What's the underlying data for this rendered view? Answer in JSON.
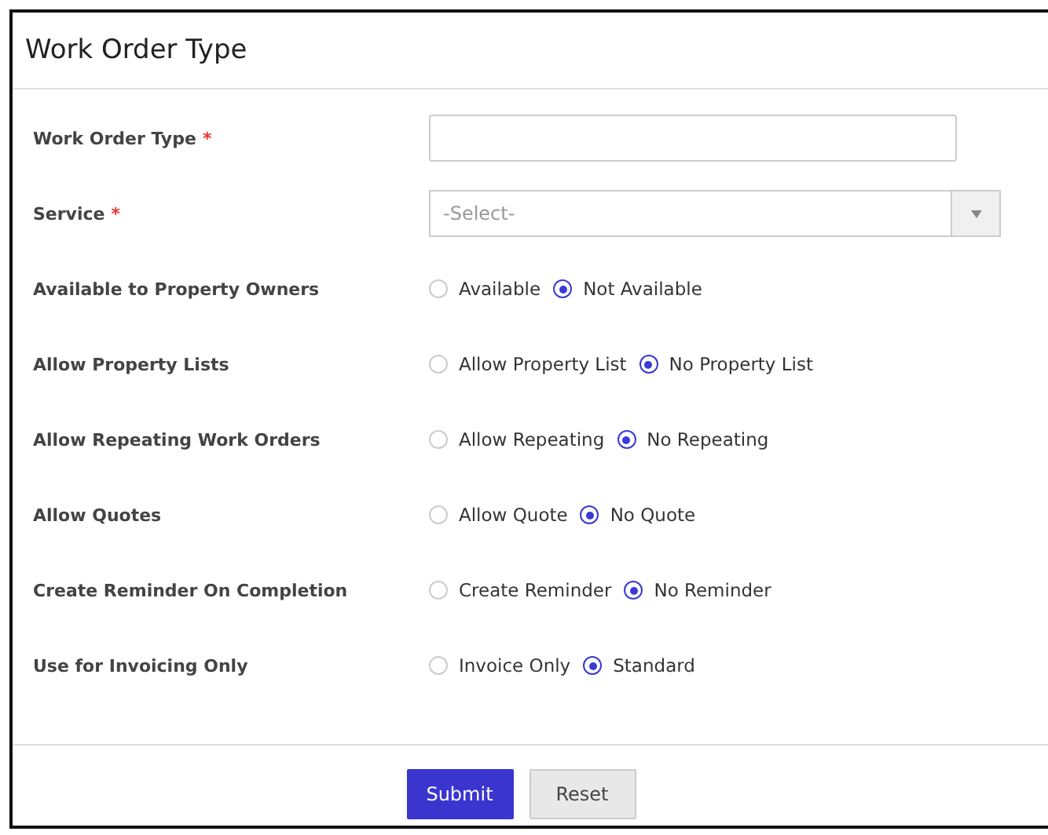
{
  "dialog": {
    "title": "Work Order Type"
  },
  "fields": [
    {
      "kind": "text",
      "label": "Work Order Type",
      "required_mark": "*"
    },
    {
      "kind": "select",
      "label": "Service",
      "required_mark": "*",
      "placeholder": "-Select-"
    },
    {
      "kind": "radio",
      "label": "Available to Property Owners",
      "options": [
        {
          "label": "Available",
          "selected": false
        },
        {
          "label": "Not Available",
          "selected": true
        }
      ]
    },
    {
      "kind": "radio",
      "label": "Allow Property Lists",
      "options": [
        {
          "label": "Allow Property List",
          "selected": false
        },
        {
          "label": "No Property List",
          "selected": true
        }
      ]
    },
    {
      "kind": "radio",
      "label": "Allow Repeating Work Orders",
      "options": [
        {
          "label": "Allow Repeating",
          "selected": false
        },
        {
          "label": "No Repeating",
          "selected": true
        }
      ]
    },
    {
      "kind": "radio",
      "label": "Allow Quotes",
      "options": [
        {
          "label": "Allow Quote",
          "selected": false
        },
        {
          "label": "No Quote",
          "selected": true
        }
      ]
    },
    {
      "kind": "radio",
      "label": "Create Reminder On Completion",
      "options": [
        {
          "label": "Create Reminder",
          "selected": false
        },
        {
          "label": "No Reminder",
          "selected": true
        }
      ]
    },
    {
      "kind": "radio",
      "label": "Use for Invoicing Only",
      "options": [
        {
          "label": "Invoice Only",
          "selected": false
        },
        {
          "label": "Standard",
          "selected": true
        }
      ]
    }
  ],
  "buttons": [
    {
      "label": "Submit",
      "kind": "primary"
    },
    {
      "label": "Reset",
      "kind": "secondary"
    }
  ]
}
